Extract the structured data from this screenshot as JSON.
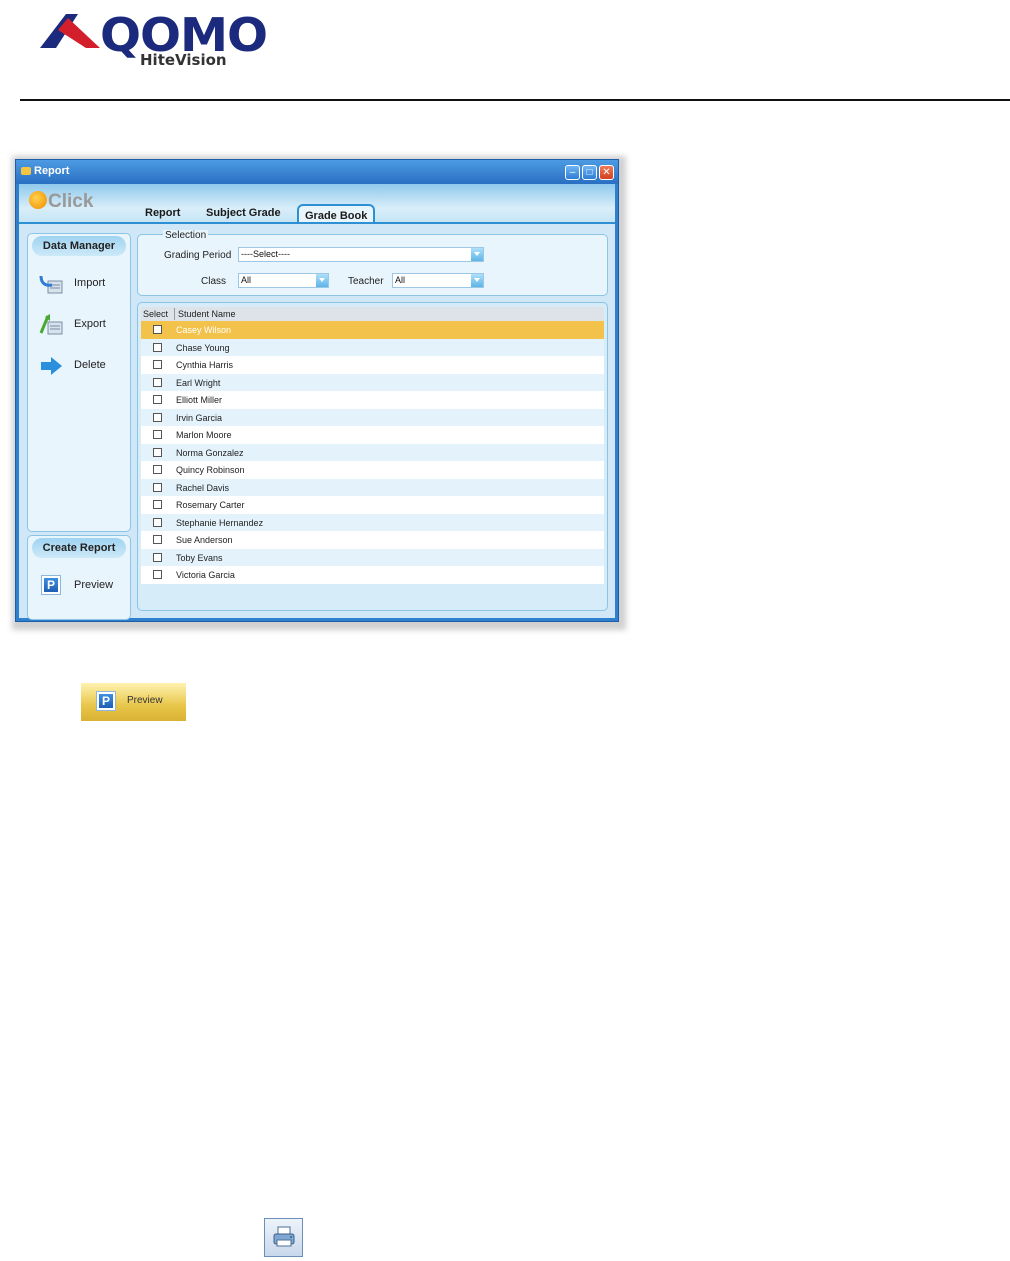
{
  "logo": {
    "brand": "QOMO",
    "sub": "HiteVision"
  },
  "window": {
    "title": "Report",
    "brand_label": "Click",
    "tabs": [
      {
        "label": "Report"
      },
      {
        "label": "Subject Grade"
      },
      {
        "label": "Grade Book",
        "active": true
      }
    ],
    "data_manager": {
      "title": "Data Manager",
      "items": [
        {
          "label": "Import"
        },
        {
          "label": "Export"
        },
        {
          "label": "Delete"
        }
      ]
    },
    "create_report": {
      "title": "Create Report",
      "preview_label": "Preview"
    },
    "selection": {
      "legend": "Selection",
      "grading_period_label": "Grading Period",
      "grading_period_value": "----Select----",
      "class_label": "Class",
      "class_value": "All",
      "teacher_label": "Teacher",
      "teacher_value": "All"
    },
    "grid": {
      "columns": [
        "Select",
        "Student Name"
      ],
      "rows": [
        {
          "name": "Casey Wilson",
          "selected": true
        },
        {
          "name": "Chase Young"
        },
        {
          "name": "Cynthia Harris"
        },
        {
          "name": "Earl Wright"
        },
        {
          "name": "Elliott Miller"
        },
        {
          "name": "Irvin Garcia"
        },
        {
          "name": "Marlon Moore"
        },
        {
          "name": "Norma Gonzalez"
        },
        {
          "name": "Quincy Robinson"
        },
        {
          "name": "Rachel Davis"
        },
        {
          "name": "Rosemary Carter"
        },
        {
          "name": "Stephanie Hernandez"
        },
        {
          "name": "Sue Anderson"
        },
        {
          "name": "Toby Evans"
        },
        {
          "name": "Victoria Garcia"
        }
      ]
    }
  },
  "preview_callout": {
    "label": "Preview",
    "icon_letter": "P"
  },
  "colors": {
    "accent": "#2e7fcc",
    "selected_row": "#f2c24b",
    "alt_row": "#e4f2fb"
  },
  "icons": {
    "print": "printer-icon"
  }
}
